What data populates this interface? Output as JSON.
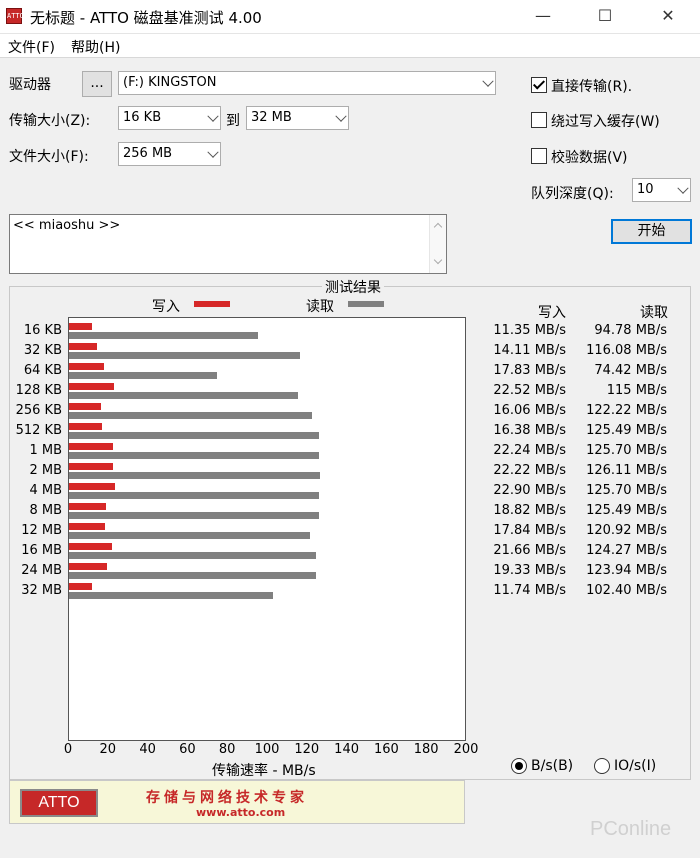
{
  "window": {
    "title": "无标题 - ATTO 磁盘基准测试 4.00",
    "minimize_glyph": "—",
    "maximize_glyph": "☐",
    "close_glyph": "✕"
  },
  "menu": [
    {
      "label": "文件(F)"
    },
    {
      "label": "帮助(H)"
    }
  ],
  "drive": {
    "label": "驱动器",
    "browse_label": "...",
    "selected": "(F:) KINGSTON"
  },
  "transfer_size": {
    "label": "传输大小(Z):",
    "from": "16 KB",
    "to_label": "到",
    "to": "32 MB"
  },
  "file_size": {
    "label": "文件大小(F):",
    "value": "256 MB"
  },
  "options": {
    "direct_io": {
      "label": "直接传输(R).",
      "checked": true
    },
    "bypass_write_cache": {
      "label": "绕过写入缓存(W)",
      "checked": false
    },
    "verify_data": {
      "label": "校验数据(V)",
      "checked": false
    },
    "queue_depth_label": "队列深度(Q):",
    "queue_depth": "10",
    "start_label": "开始"
  },
  "description": "<< miaoshu >>",
  "results": {
    "title": "测试结果",
    "legend_write": "写入",
    "legend_read": "读取",
    "col_write": "写入",
    "col_read": "读取",
    "xlabel": "传输速率 - MB/s",
    "colors": {
      "write": "#d62828",
      "read": "#808080"
    }
  },
  "chart_data": {
    "type": "bar",
    "orientation": "horizontal",
    "categories": [
      "16 KB",
      "32 KB",
      "64 KB",
      "128 KB",
      "256 KB",
      "512 KB",
      "1 MB",
      "2 MB",
      "4 MB",
      "8 MB",
      "12 MB",
      "16 MB",
      "24 MB",
      "32 MB"
    ],
    "series": [
      {
        "name": "写入",
        "values": [
          11.35,
          14.11,
          17.83,
          22.52,
          16.06,
          16.38,
          22.24,
          22.22,
          22.9,
          18.82,
          17.84,
          21.66,
          19.33,
          11.74
        ]
      },
      {
        "name": "读取",
        "values": [
          94.78,
          116.08,
          74.42,
          115,
          122.22,
          125.49,
          125.7,
          126.11,
          125.7,
          125.49,
          120.92,
          124.27,
          123.94,
          102.4
        ]
      }
    ],
    "write_text": [
      "11.35 MB/s",
      "14.11 MB/s",
      "17.83 MB/s",
      "22.52 MB/s",
      "16.06 MB/s",
      "16.38 MB/s",
      "22.24 MB/s",
      "22.22 MB/s",
      "22.90 MB/s",
      "18.82 MB/s",
      "17.84 MB/s",
      "21.66 MB/s",
      "19.33 MB/s",
      "11.74 MB/s"
    ],
    "read_text": [
      "94.78 MB/s",
      "116.08 MB/s",
      "74.42 MB/s",
      "115 MB/s",
      "122.22 MB/s",
      "125.49 MB/s",
      "125.70 MB/s",
      "126.11 MB/s",
      "125.70 MB/s",
      "125.49 MB/s",
      "120.92 MB/s",
      "124.27 MB/s",
      "123.94 MB/s",
      "102.40 MB/s"
    ],
    "xticks": [
      0,
      20,
      40,
      60,
      80,
      100,
      120,
      140,
      160,
      180,
      200
    ],
    "xlim": [
      0,
      200
    ],
    "xlabel": "传输速率 - MB/s",
    "grid": false
  },
  "units": {
    "bytes": {
      "label": "B/s(B)",
      "selected": true
    },
    "io": {
      "label": "IO/s(I)",
      "selected": false
    }
  },
  "banner": {
    "logo": "ATTO",
    "slogan": "存储与网络技术专家",
    "url": "www.atto.com"
  },
  "watermark": "PConline"
}
